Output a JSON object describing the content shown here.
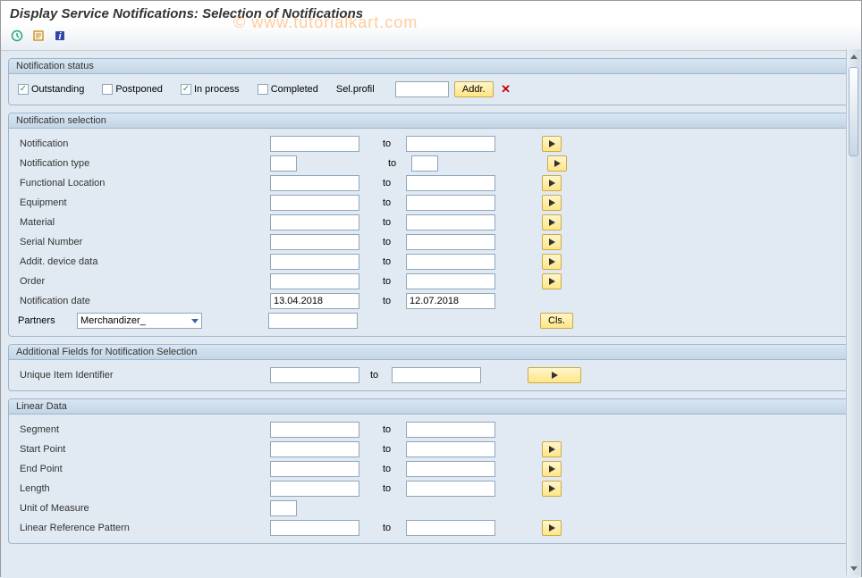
{
  "page_title": "Display Service Notifications: Selection of Notifications",
  "watermark": "© www.tutorialkart.com",
  "toolbar": {
    "icons": [
      "execute-icon",
      "get-variant-icon",
      "info-icon"
    ]
  },
  "status_group": {
    "title": "Notification status",
    "outstanding": {
      "label": "Outstanding",
      "checked": true
    },
    "postponed": {
      "label": "Postponed",
      "checked": false
    },
    "in_process": {
      "label": "In process",
      "checked": true
    },
    "completed": {
      "label": "Completed",
      "checked": false
    },
    "sel_profil_label": "Sel.profil",
    "sel_profil_value": "",
    "addr_btn": "Addr.",
    "clear_icon": "✕"
  },
  "selection_group": {
    "title": "Notification selection",
    "to": "to",
    "rows": {
      "notification": "Notification",
      "notif_type": "Notification type",
      "func_loc": "Functional Location",
      "equipment": "Equipment",
      "material": "Material",
      "serial": "Serial Number",
      "addit_device": "Addit. device data",
      "order": "Order",
      "notif_date": "Notification date",
      "partners": "Partners"
    },
    "date_from": "13.04.2018",
    "date_to": "12.07.2018",
    "partners_value": "Merchandizer_",
    "cls_btn": "Cls."
  },
  "additional_group": {
    "title": "Additional Fields for Notification Selection",
    "uid_label": "Unique Item Identifier",
    "to": "to"
  },
  "linear_group": {
    "title": "Linear Data",
    "segment": "Segment",
    "start_point": "Start Point",
    "end_point": "End Point",
    "length": "Length",
    "uom": "Unit of Measure",
    "lrp": "Linear Reference Pattern",
    "to": "to"
  }
}
